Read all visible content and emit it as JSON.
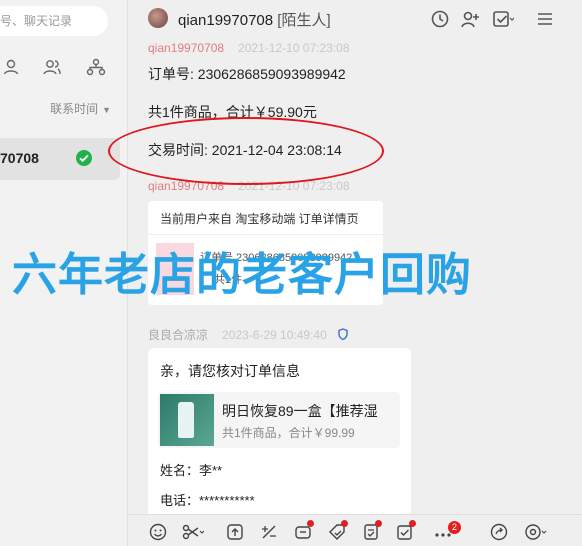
{
  "sidebar": {
    "search_placeholder": "号、聊天记录",
    "sort_label": "联系时间",
    "contact": {
      "name": "70708"
    }
  },
  "header": {
    "username": "qian19970708",
    "tag": "[陌生人]"
  },
  "messages": {
    "m1": {
      "sender": "qian19970708",
      "time": "2021-12-10 07:23:08",
      "order_no": "订单号: 2306286859093989942",
      "summary": "共1件商品，合计￥59.90元",
      "trade_time": "交易时间: 2021-12-04 23:08:14"
    },
    "m2": {
      "sender": "qian19970708",
      "time": "2021-12-10 07:23:08",
      "card_title": "当前用户来自 淘宝移动端 订单详情页",
      "goods_line1": "订单号 2306286859093989942",
      "goods_line2": "共1件"
    },
    "m3": {
      "sender": "良良合凉凉",
      "time": "2023-6-29 10:49:40",
      "question": "亲，请您核对订单信息",
      "product_name": "明日恢复89一盒【推荐湿",
      "product_sub": "共1件商品，合计￥99.99",
      "name_field": "姓名：李**",
      "phone_field": "电话：***********"
    }
  },
  "overlay_text": "六年老店的老客户回购",
  "toolbar": {
    "badge_count": "2"
  },
  "colors": {
    "accent_red": "#e0161b",
    "overlay_blue": "#2aa3e6",
    "verified_green": "#22b14c"
  }
}
